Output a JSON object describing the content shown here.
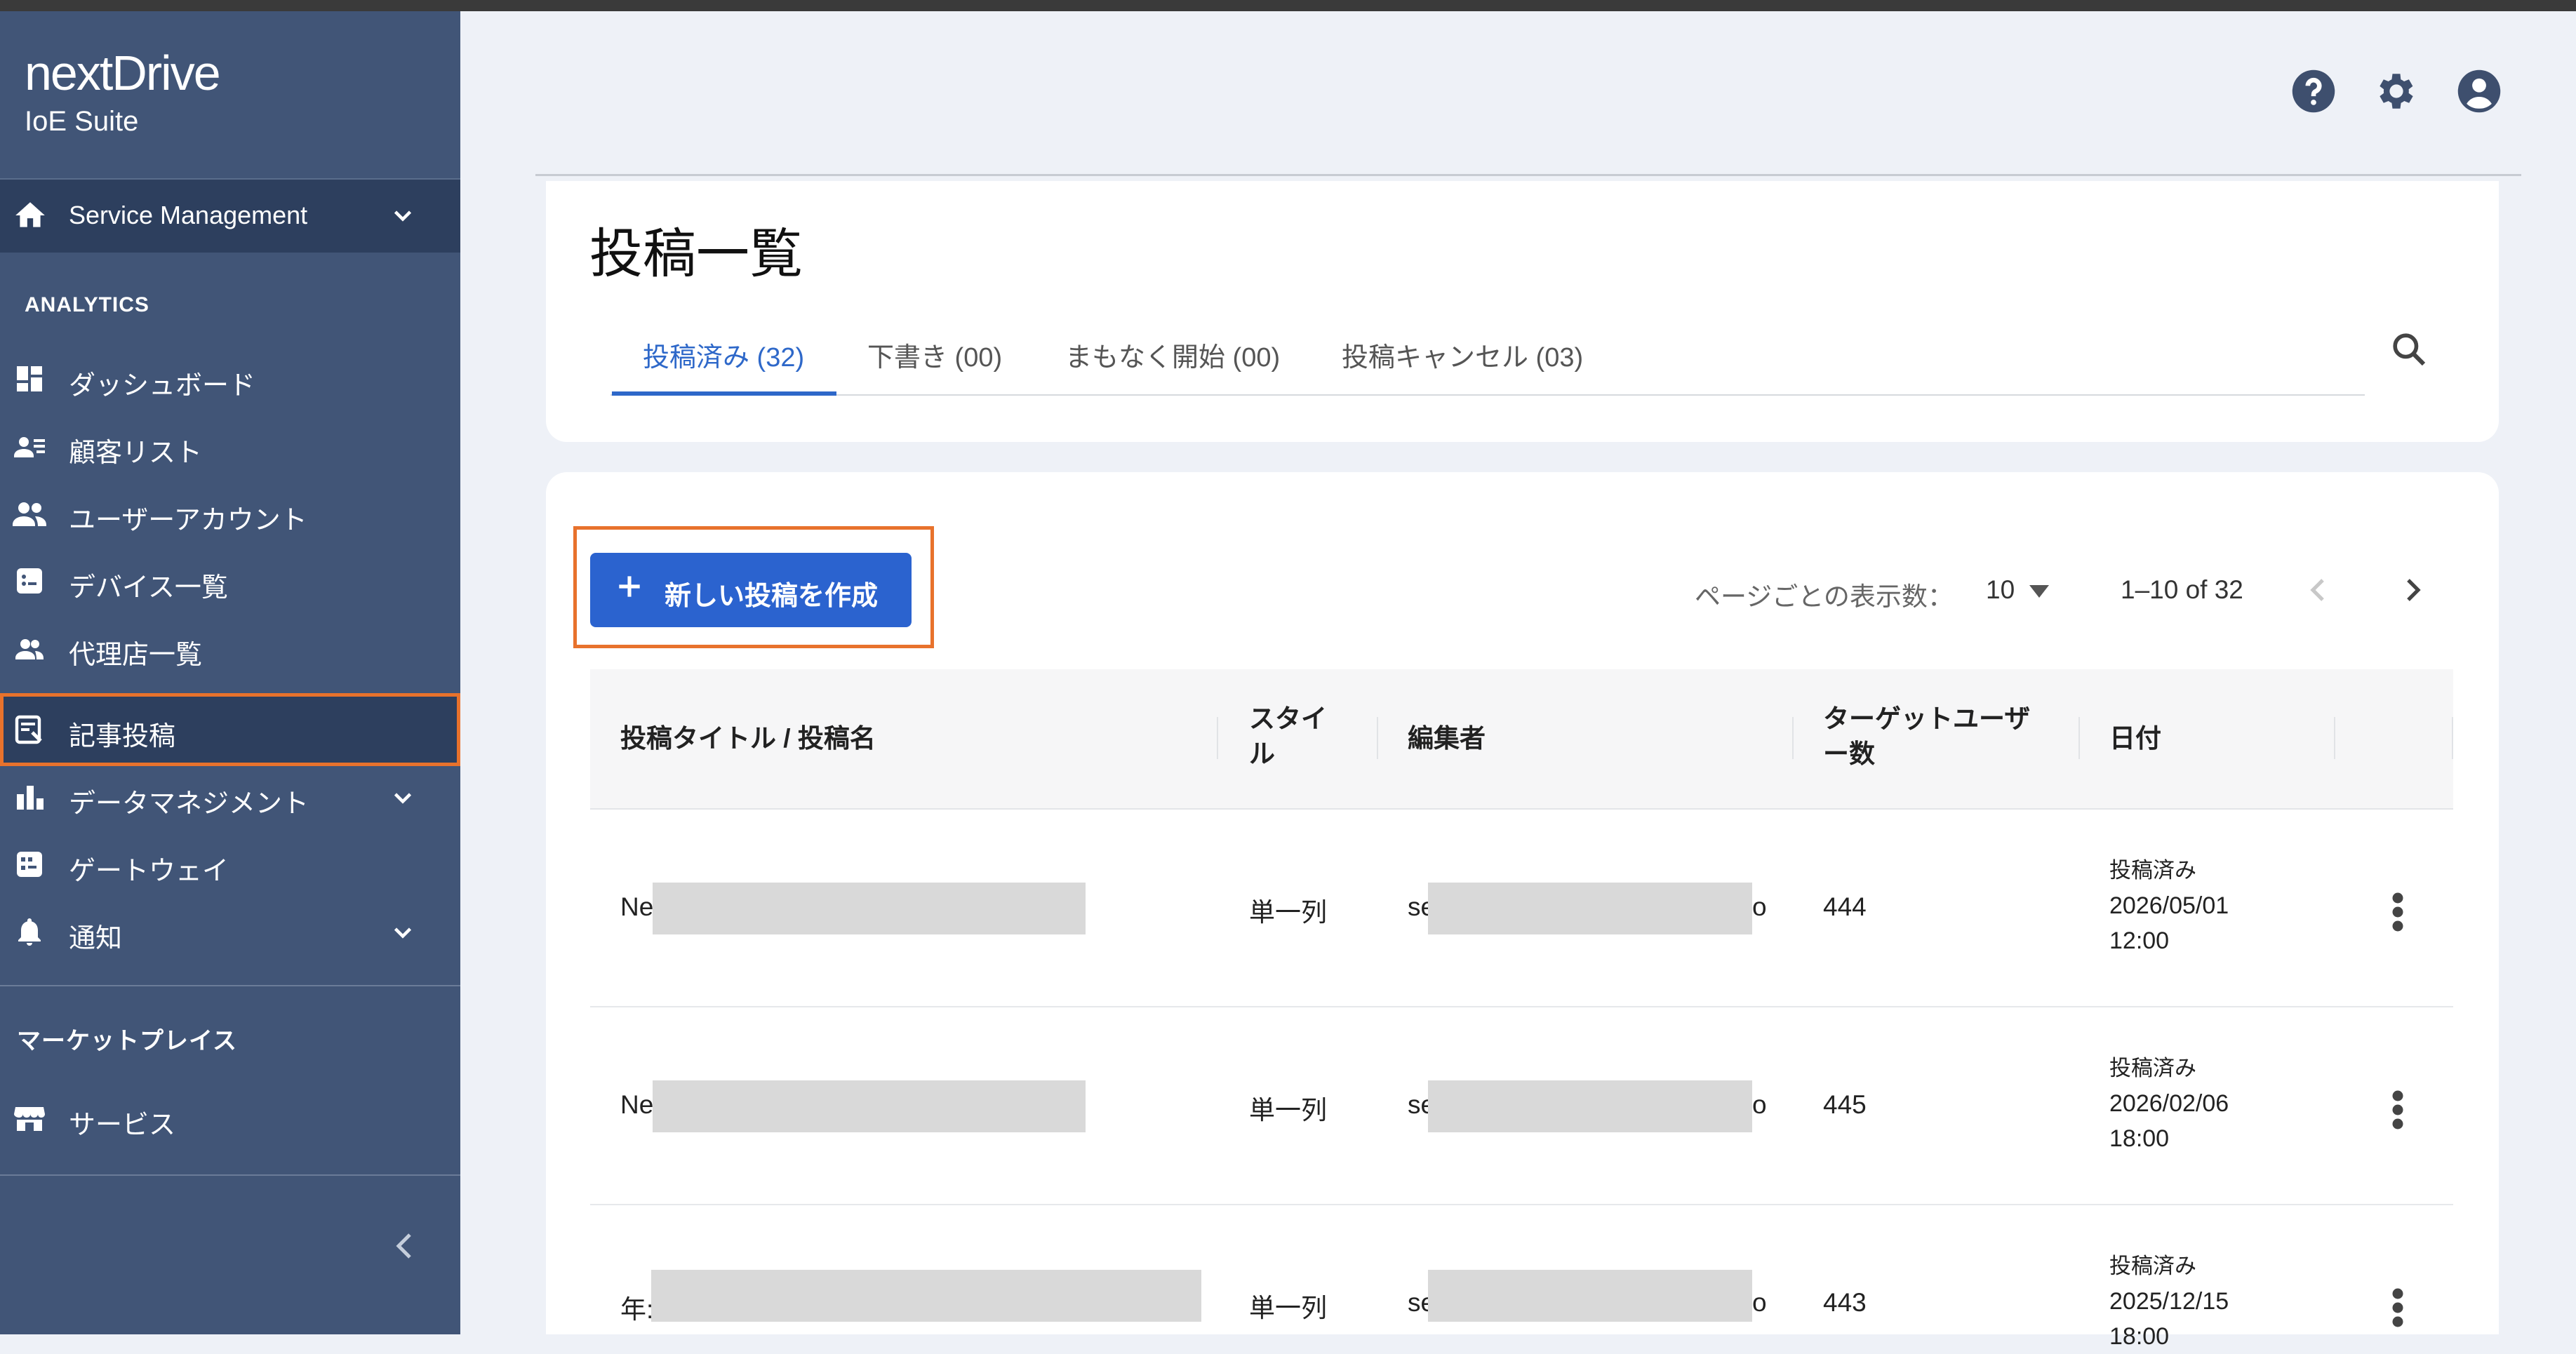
{
  "sidebar": {
    "logo": "nextDrive",
    "suite": "IoE Suite",
    "service_management": "Service Management",
    "section_analytics": "ANALYTICS",
    "items": [
      {
        "label": "ダッシュボード"
      },
      {
        "label": "顧客リスト"
      },
      {
        "label": "ユーザーアカウント"
      },
      {
        "label": "デバイス一覧"
      },
      {
        "label": "代理店一覧"
      },
      {
        "label": "記事投稿"
      },
      {
        "label": "データマネジメント"
      },
      {
        "label": "ゲートウェイ"
      },
      {
        "label": "通知"
      }
    ],
    "section_marketplace": "マーケットプレイス",
    "marketplace_items": [
      {
        "label": "サービス"
      }
    ]
  },
  "header": {
    "icons": [
      "help-icon",
      "settings-gear-icon",
      "account-circle-icon"
    ]
  },
  "page": {
    "title": "投稿一覧",
    "tabs": [
      {
        "label": "投稿済み (32)",
        "active": true
      },
      {
        "label": "下書き (00)"
      },
      {
        "label": "まもなく開始 (00)"
      },
      {
        "label": "投稿キャンセル (03)"
      }
    ]
  },
  "toolbar": {
    "create_label": "新しい投稿を作成",
    "per_page_label": "ページごとの表示数：",
    "per_page_value": "10",
    "range": "1–10 of 32"
  },
  "table": {
    "headers": {
      "title": "投稿タイトル / 投稿名",
      "style_l1": "スタイ",
      "style_l2": "ル",
      "editor": "編集者",
      "target_l1": "ターゲットユーザ",
      "target_l2": "ー数",
      "date": "日付"
    },
    "rows": [
      {
        "title_prefix": "Ne",
        "style": "単一列",
        "editor_prefix": "se",
        "editor_suffix": "o",
        "target": "444",
        "status": "投稿済み",
        "date": "2026/05/01",
        "time": "12:00"
      },
      {
        "title_prefix": "Ne",
        "style": "単一列",
        "editor_prefix": "se",
        "editor_suffix": "o",
        "target": "445",
        "status": "投稿済み",
        "date": "2026/02/06",
        "time": "18:00"
      },
      {
        "title_prefix": "年:",
        "style": "単一列",
        "editor_prefix": "se",
        "editor_suffix": "o",
        "target": "443",
        "status": "投稿済み",
        "date": "2025/12/15",
        "time": "18:00"
      }
    ]
  },
  "colors": {
    "sidebar_bg": "#415577",
    "accent_blue": "#2b63cf",
    "highlight_orange": "#e8722c"
  }
}
